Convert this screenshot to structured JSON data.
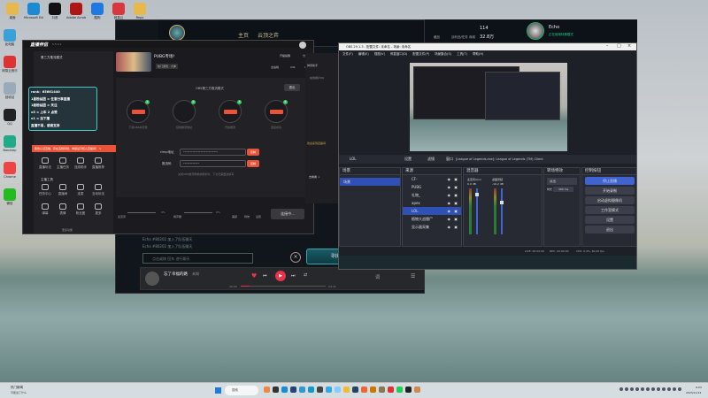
{
  "desktop": {
    "icons": [
      {
        "label": "桌面",
        "color": "#e8b84a"
      },
      {
        "label": "Microsoft Edge",
        "color": "#1a8ad4"
      },
      {
        "label": "抖音",
        "color": "#111"
      },
      {
        "label": "Adobe Acrobat",
        "color": "#b01515"
      },
      {
        "label": "酷狗",
        "color": "#1e7ae0"
      },
      {
        "label": "网易云",
        "color": "#d9363e"
      },
      {
        "label": "Repo",
        "color": "#e8b84a"
      }
    ],
    "side_icons": [
      {
        "label": "此电脑",
        "color": "#3aa0d8"
      },
      {
        "label": "网易云音乐",
        "color": "#d33"
      },
      {
        "label": "回收站",
        "color": "#9ab"
      },
      {
        "label": "QQ",
        "color": "#222"
      },
      {
        "label": "Bandizip",
        "color": "#2a8"
      },
      {
        "label": "Chrome",
        "color": "#e44"
      },
      {
        "label": "微信",
        "color": "#2b2"
      }
    ]
  },
  "lol": {
    "nav": [
      "主页",
      "云顶之弈"
    ],
    "store": [
      "藏品",
      "战利品/任务",
      "商城"
    ],
    "currency_rp": "114",
    "currency_be": "32.8万",
    "username": "Echo",
    "status": "正在使用特殊模式",
    "chat": [
      "Echo #80202 加入了队伍聊天",
      "Echo #80202 加入了队伍聊天"
    ],
    "chat_placeholder": "点击或按 回车 进行聊天",
    "find_match": "寻找对局"
  },
  "music": {
    "song": "忘了幸福的路",
    "artist": "未知",
    "time_current": "00:00",
    "time_total": "04:32",
    "progress": 0.1,
    "lyric": "词"
  },
  "streamer": {
    "title": "直播伴侣",
    "version": "5.5.3.2",
    "mode": "第三方推流模式",
    "room_title": "PUBG专场!",
    "category": "热门游戏 · 大神",
    "cover_label": "更换封面",
    "remind": "开播提醒",
    "share": "分享",
    "rank": "全站榜",
    "likes": "241",
    "hearts": "0",
    "obs_mode_title": "OBS第三方推流模式",
    "exit": "退出",
    "steps": [
      {
        "label": "下载OBS并安装",
        "badge": "1"
      },
      {
        "label": "复制推流地址",
        "badge": "2"
      },
      {
        "label": "开启推流",
        "badge": "3"
      },
      {
        "label": "连接成功",
        "badge": "4"
      }
    ],
    "rtmp_label": "rtmp地址",
    "rtmp_value": "**************************",
    "key_label": "推流码",
    "key_value": "************",
    "copy": "复制",
    "hint": "关闭OBS推流再重新刷新时，下次无需更改填写",
    "notice": "警告认证直播，存在违规风险，举报后可核心直播间！",
    "overlay": [
      "rank：65661440",
      "1星粉丝团 = 任意分享直播",
      "1级粉丝团 = 关注",
      "x5 = 上车 2 点赞",
      "x1 = 加下播",
      "直播不易，感谢支持"
    ],
    "tools_title": "主播工具",
    "tools": [
      "直播玩法",
      "主播任务",
      "连线助手",
      "直播推荐",
      "任务中心",
      "直播间",
      "连麦",
      "互动玩法",
      "弹幕",
      "表情",
      "粉丝团",
      "更多"
    ],
    "more": "更多功能",
    "mic": "麦克风",
    "speaker": "扬声器",
    "mic_pct": "0%",
    "spk_pct": "0%",
    "beauty": "美颜",
    "effects": "特效",
    "settings": "设置",
    "connecting": "连接中...",
    "side_panel": [
      "弹幕助手",
      "在线用户(0)",
      "欢迎来到直播间",
      "去看看 >"
    ]
  },
  "obs": {
    "title": "OBS 29.1.3 - 配置文件: 未命名 - 场景: 未命名",
    "menu": [
      "文件(F)",
      "编辑(E)",
      "视图(V)",
      "停靠窗口(D)",
      "配置文件(P)",
      "场景集合(S)",
      "工具(T)",
      "帮助(H)"
    ],
    "source_name": "LOL",
    "props": "设置",
    "filters": "滤镜",
    "window_label": "窗口",
    "window_value": "[League of Legends.exe]: League of Legends (TM) Client",
    "docks": {
      "scenes": "场景",
      "sources": "来源",
      "mixer": "混音器",
      "transitions": "转场特效",
      "controls": "控制按钮"
    },
    "scenes": [
      "场景"
    ],
    "sources": [
      {
        "name": "CF-",
        "selected": false
      },
      {
        "name": "PUBG",
        "selected": false
      },
      {
        "name": "礼物_",
        "selected": false
      },
      {
        "name": "apex",
        "selected": false
      },
      {
        "name": "LOL",
        "selected": true
      },
      {
        "name": "植物大战僵尸",
        "selected": false
      },
      {
        "name": "显示器采集",
        "selected": false
      }
    ],
    "mixer": [
      {
        "name": "麦克风/Aux",
        "db": "0.0 dB",
        "level": 0.9
      },
      {
        "name": "桌面音频",
        "db": "-10.2 dB",
        "level": 0.7
      }
    ],
    "transition": "淡出",
    "duration_label": "时长",
    "duration": "300 ms",
    "controls": [
      "停止直播",
      "开始录制",
      "启动虚拟摄像机",
      "工作室模式",
      "设置",
      "退出"
    ],
    "status": {
      "live": "LIVE: 00:00:00",
      "rec": "REC: 00:00:00",
      "cpu": "CPU: 0.4%, 60.00 fps"
    }
  },
  "taskbar": {
    "news": "热门新闻",
    "news_sub": "可能说了什么",
    "search": "搜索",
    "time": "9:03",
    "date": "2023/11/14"
  },
  "colors": {
    "obs_blue": "#3f63d0",
    "accent_red": "#e8533a",
    "music_red": "#e8334a"
  }
}
